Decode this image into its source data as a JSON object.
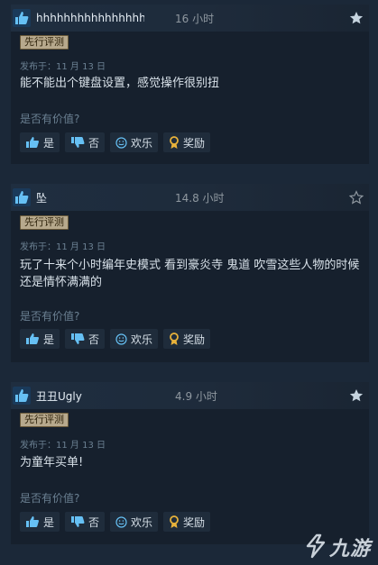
{
  "reviews": [
    {
      "username": "hhhhhhhhhhhhhhhh",
      "hours": "16 小时",
      "badge": "先行评测",
      "date": "发布于：11 月 13 日",
      "content": "能不能出个键盘设置，感觉操作很别扭",
      "helpful_prompt": "是否有价值?",
      "buttons": {
        "yes": "是",
        "no": "否",
        "funny": "欢乐",
        "award": "奖励"
      }
    },
    {
      "username": "坠",
      "hours": "14.8 小时",
      "badge": "先行评测",
      "date": "发布于：11 月 13 日",
      "content": "玩了十来个小时编年史模式 看到豪炎寺 鬼道 吹雪这些人物的时候还是情怀满满的",
      "helpful_prompt": "是否有价值?",
      "buttons": {
        "yes": "是",
        "no": "否",
        "funny": "欢乐",
        "award": "奖励"
      }
    },
    {
      "username": "丑丑Ugly",
      "hours": "4.9 小时",
      "badge": "先行评测",
      "date": "发布于：11 月 13 日",
      "content": "为童年买单!",
      "helpful_prompt": "是否有价值?",
      "buttons": {
        "yes": "是",
        "no": "否",
        "funny": "欢乐",
        "award": "奖励"
      }
    }
  ],
  "watermark": {
    "text": "九游"
  },
  "colors": {
    "thumb": "#66c0f4",
    "award": "#e8b23a",
    "badge_bg": "#b7a98d"
  }
}
